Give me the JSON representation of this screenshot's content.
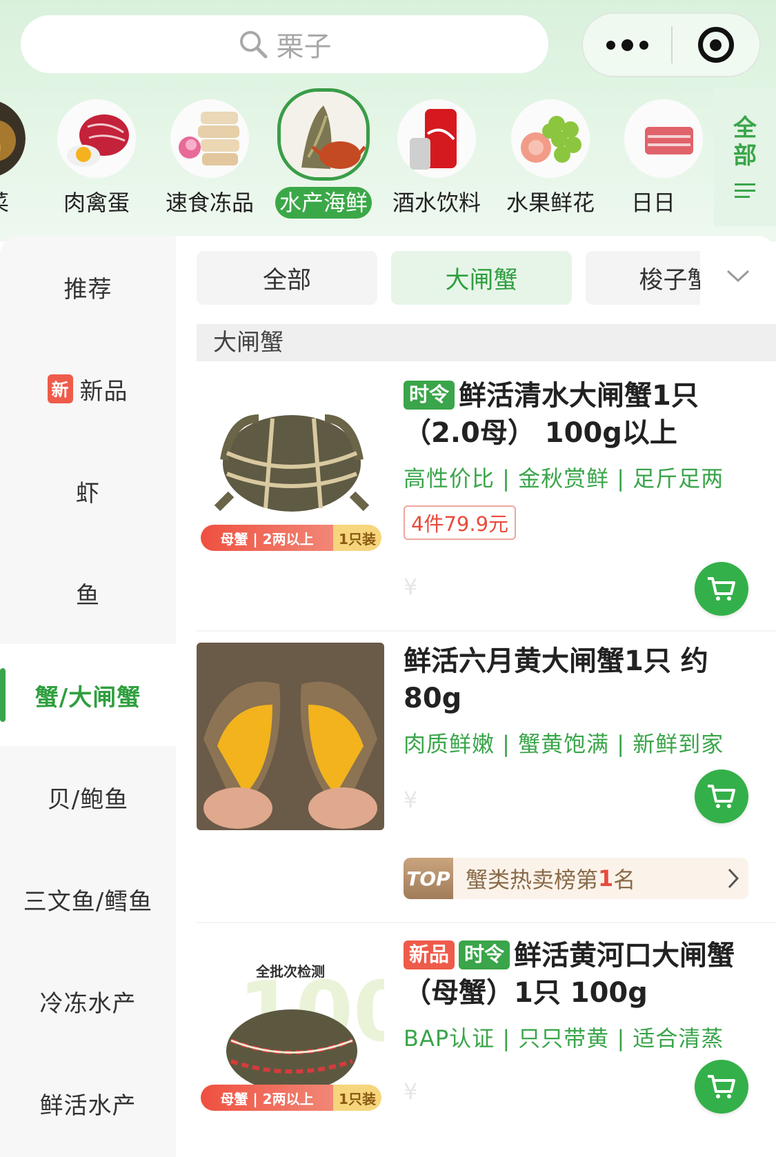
{
  "search": {
    "placeholder": "栗子"
  },
  "categories": [
    {
      "label": "菜"
    },
    {
      "label": "肉禽蛋"
    },
    {
      "label": "速食冻品"
    },
    {
      "label": "水产海鲜",
      "active": true
    },
    {
      "label": "酒水饮料"
    },
    {
      "label": "水果鲜花"
    },
    {
      "label": "日日"
    }
  ],
  "all_button": {
    "line1": "全",
    "line2": "部"
  },
  "sidebar": {
    "items": [
      {
        "label": "推荐"
      },
      {
        "label": "新品",
        "badge": "新"
      },
      {
        "label": "虾"
      },
      {
        "label": "鱼"
      },
      {
        "label": "蟹/大闸蟹",
        "active": true
      },
      {
        "label": "贝/鲍鱼"
      },
      {
        "label": "三文鱼/鳕鱼"
      },
      {
        "label": "冷冻水产"
      },
      {
        "label": "鲜活水产"
      }
    ]
  },
  "subtabs": [
    {
      "label": "全部"
    },
    {
      "label": "大闸蟹",
      "active": true
    },
    {
      "label": "梭子蟹"
    }
  ],
  "section_title": "大闸蟹",
  "products": [
    {
      "tags": [
        "时令"
      ],
      "title": "鲜活清水大闸蟹1只（2.0母） 100g以上",
      "subtitle": "高性价比 | 金秋赏鲜 | 足斤足两",
      "promo": "4件79.9元",
      "price": "¥",
      "image_banner": {
        "left": "母蟹 | 2两以上",
        "right": "1只装"
      }
    },
    {
      "tags": [],
      "title": "鲜活六月黄大闸蟹1只 约80g",
      "subtitle": "肉质鲜嫩 | 蟹黄饱满 | 新鲜到家",
      "price": "¥",
      "rank": {
        "badge": "TOP",
        "prefix": "蟹类热卖榜第",
        "num": "1",
        "suffix": "名"
      }
    },
    {
      "tags": [
        "新品",
        "时令"
      ],
      "title": "鲜活黄河口大闸蟹（母蟹）1只 100g",
      "subtitle": "BAP认证 | 只只带黄 | 适合清蒸",
      "price": "¥",
      "image_text": "全批次检测",
      "image_banner": {
        "left": "母蟹 | 2两以上",
        "right": "1只装"
      }
    }
  ],
  "colors": {
    "accent": "#3aa54a",
    "promo_red": "#e84b3c",
    "header_bg": "#d9f1dc"
  },
  "icons": [
    "search-icon",
    "more-dots-icon",
    "target-icon",
    "list-icon",
    "chevron-down-icon",
    "cart-icon",
    "chevron-right-icon"
  ]
}
